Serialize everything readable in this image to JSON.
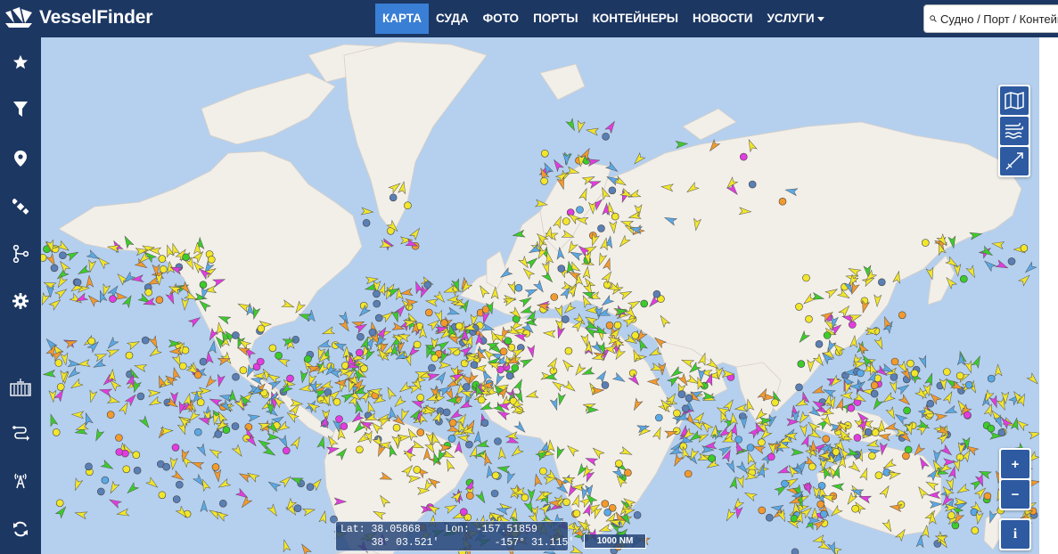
{
  "brand": {
    "name_part1": "Vessel",
    "name_part2": "Finder"
  },
  "nav": {
    "items": [
      {
        "label": "КАРТА",
        "active": true
      },
      {
        "label": "СУДА",
        "active": false
      },
      {
        "label": "ФОТО",
        "active": false
      },
      {
        "label": "ПОРТЫ",
        "active": false
      },
      {
        "label": "КОНТЕЙНЕРЫ",
        "active": false
      },
      {
        "label": "НОВОСТИ",
        "active": false
      },
      {
        "label": "УСЛУГИ",
        "active": false,
        "dropdown": true
      }
    ]
  },
  "search": {
    "placeholder": "Судно / Порт / Контейнер"
  },
  "sidebar": {
    "items": [
      {
        "icon": "star-icon"
      },
      {
        "icon": "filter-icon"
      },
      {
        "icon": "map-pin-icon"
      },
      {
        "icon": "satellite-icon"
      },
      {
        "icon": "route-icon"
      },
      {
        "icon": "gear-icon"
      },
      {
        "icon": "container-ship-icon"
      },
      {
        "icon": "voyage-icon"
      },
      {
        "icon": "antenna-icon"
      },
      {
        "icon": "refresh-icon"
      }
    ]
  },
  "map_controls": {
    "layers": [
      "map-layer-icon",
      "wind-layer-icon",
      "compass-layer-icon"
    ],
    "zoom_in": "+",
    "zoom_out": "−",
    "info": "i"
  },
  "coords": {
    "lat_label": "Lat:",
    "lat_decimal": "38.05868",
    "lon_label": "Lon:",
    "lon_decimal": "-157.51859",
    "lat_dms": "38° 03.521′",
    "lon_dms": "-157° 31.115′"
  },
  "scale": {
    "label": "1000 NM"
  },
  "colors": {
    "header_bg": "#1c3762",
    "nav_active": "#3a7fd6",
    "sea": "#b5d0ee",
    "land": "#f2efe9",
    "cargo_yellow": "#f2e62b",
    "tanker_orange": "#f39a2c",
    "passenger_blue": "#5aa9e6",
    "special_magenta": "#e33ce0",
    "fishing_green": "#3ccc2a"
  }
}
